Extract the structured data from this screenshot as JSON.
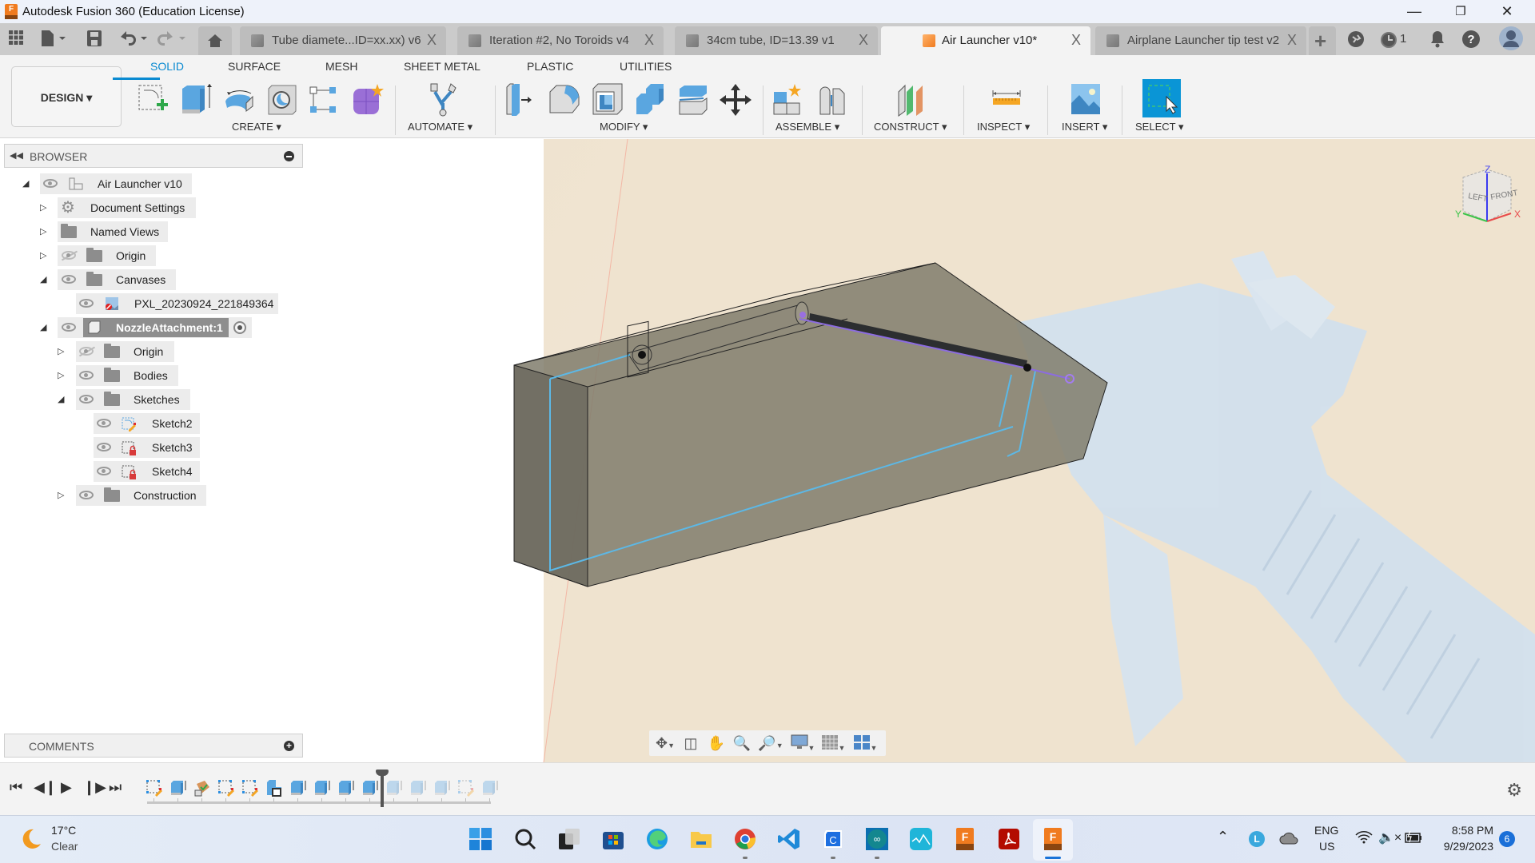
{
  "window": {
    "title": "Autodesk Fusion 360 (Education License)",
    "controls": [
      "minimize",
      "restore",
      "close"
    ]
  },
  "quick_access": {
    "icons": [
      "grid-menu-icon",
      "file-icon",
      "save-icon",
      "undo-icon",
      "redo-icon",
      "home-icon"
    ]
  },
  "tabs": [
    {
      "label": "Tube diamete...ID=xx.xx) v6",
      "active": false
    },
    {
      "label": "Iteration #2, No Toroids v4",
      "active": false
    },
    {
      "label": "34cm tube, ID=13.39 v1",
      "active": false
    },
    {
      "label": "Air Launcher v10*",
      "active": true
    },
    {
      "label": "Airplane Launcher tip test v2",
      "active": false
    }
  ],
  "tab_close_glyph": "X",
  "header_right": {
    "job_status_count": "1"
  },
  "toolbar": {
    "workspace": "DESIGN ▾",
    "workspace_tabs": [
      "SOLID",
      "SURFACE",
      "MESH",
      "SHEET METAL",
      "PLASTIC",
      "UTILITIES"
    ],
    "active_tab": "SOLID",
    "groups": {
      "create": "CREATE ▾",
      "automate": "AUTOMATE ▾",
      "modify": "MODIFY ▾",
      "assemble": "ASSEMBLE ▾",
      "construct": "CONSTRUCT ▾",
      "inspect": "INSPECT ▾",
      "insert": "INSERT ▾",
      "select": "SELECT ▾"
    }
  },
  "browser": {
    "title": "BROWSER",
    "tree": [
      {
        "label": "Air Launcher v10",
        "expanded": true,
        "visible": true
      },
      {
        "label": "Document Settings",
        "expanded": false
      },
      {
        "label": "Named Views",
        "expanded": false
      },
      {
        "label": "Origin",
        "expanded": false,
        "visible": false
      },
      {
        "label": "Canvases",
        "expanded": true,
        "visible": true
      },
      {
        "label": "PXL_20230924_221849364",
        "visible": true
      },
      {
        "label": "NozzleAttachment:1",
        "expanded": true,
        "visible": true,
        "selected": true
      },
      {
        "label": "Origin",
        "expanded": false,
        "visible": false
      },
      {
        "label": "Bodies",
        "expanded": false,
        "visible": true
      },
      {
        "label": "Sketches",
        "expanded": true,
        "visible": true
      },
      {
        "label": "Sketch2",
        "visible": true
      },
      {
        "label": "Sketch3",
        "visible": true
      },
      {
        "label": "Sketch4",
        "visible": true
      },
      {
        "label": "Construction",
        "expanded": false,
        "visible": true
      }
    ]
  },
  "viewcube": {
    "axis_x": "X",
    "axis_y": "Y",
    "axis_z": "Z",
    "face_front": "FRONT",
    "face_left": "LEFT"
  },
  "comments": {
    "title": "COMMENTS"
  },
  "nav_bar": {
    "icons": [
      "orbit-icon",
      "look-at-icon",
      "pan-icon",
      "zoom-icon",
      "fit-icon",
      "display-settings-icon",
      "grid-icon",
      "viewports-icon"
    ]
  },
  "timeline": {
    "controls": [
      "go-to-start",
      "step-back",
      "play",
      "step-forward",
      "go-to-end"
    ],
    "features": [
      "sketch",
      "extrude",
      "canvas",
      "sketch",
      "sketch",
      "combine",
      "extrude",
      "extrude",
      "extrude",
      "extrude",
      "extrude",
      "extrude",
      "extrude",
      "sketch",
      "extrude"
    ],
    "marker_after_index": 9
  },
  "taskbar": {
    "weather": {
      "temp": "17°C",
      "condition": "Clear"
    },
    "apps": [
      "windows-start",
      "search",
      "task-view",
      "microsoft-store",
      "edge",
      "file-explorer",
      "chrome",
      "vscode",
      "c-app",
      "arduino",
      "wave-app",
      "fusion-360",
      "acrobat",
      "fusion-360-active"
    ],
    "tray": {
      "language_line1": "ENG",
      "language_line2": "US",
      "time": "8:58 PM",
      "date": "9/29/2023",
      "notification_count": "6"
    }
  },
  "colors": {
    "accent": "#0a8ad1",
    "fusion_orange": "#f07b1f",
    "body_gray": "#7a7766",
    "sketch_blue": "#5cb8e6",
    "canvas_bg": "#efe3d0",
    "launcher_blue": "#cfe1f2"
  }
}
